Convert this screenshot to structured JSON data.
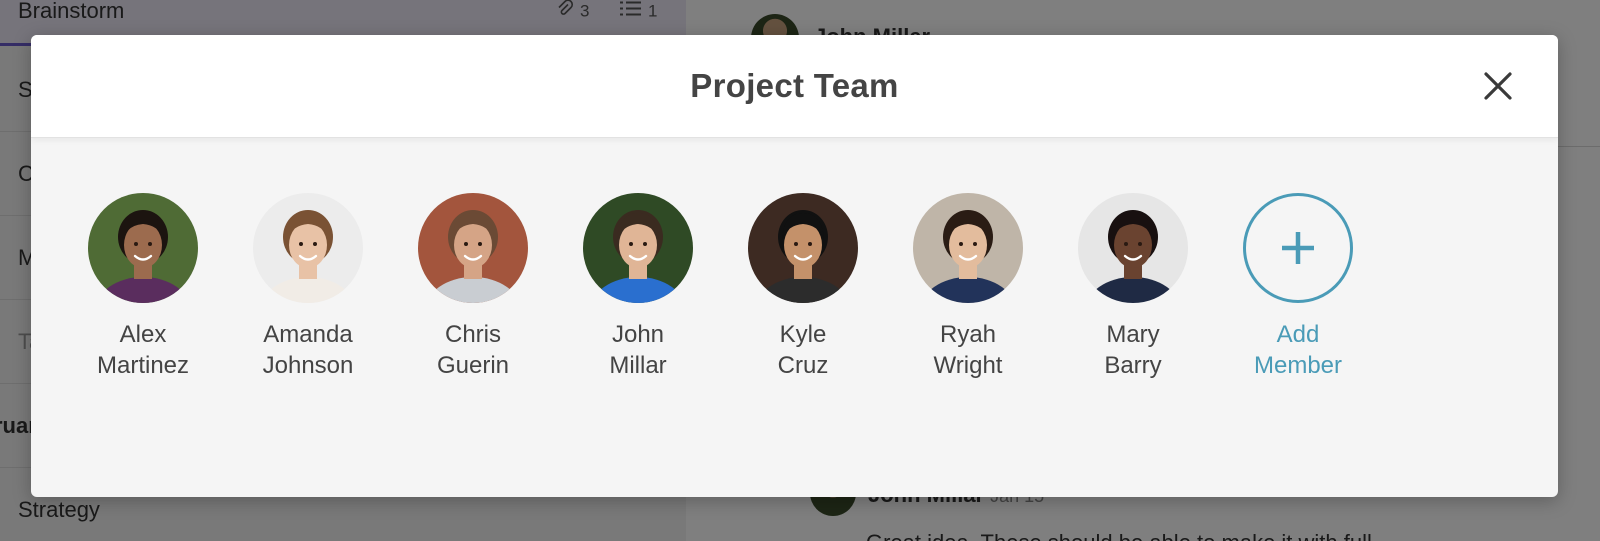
{
  "background": {
    "tasks": [
      {
        "label": "Brainstorm",
        "attachments": "3",
        "checklist": "1"
      },
      {
        "label": "S"
      },
      {
        "label": "C"
      },
      {
        "label": "M"
      },
      {
        "label": "Ta"
      },
      {
        "label": "ruar"
      },
      {
        "label": "Strategy"
      }
    ],
    "header_name": "John Millar",
    "comment": {
      "author": "John Millar",
      "date": "Jan 15",
      "text": "Great idea. These should be able to make it with full..."
    }
  },
  "modal": {
    "title": "Project Team",
    "close_icon": "close-icon",
    "members": [
      {
        "first": "Alex",
        "last": "Martinez",
        "skin": "#9c6b4e",
        "hair": "#1c1410",
        "shirt": "#5a2d5e",
        "bg": "#4f6b35"
      },
      {
        "first": "Amanda",
        "last": "Johnson",
        "skin": "#e8c2a6",
        "hair": "#7a5234",
        "shirt": "#f1ece6",
        "bg": "#ececec"
      },
      {
        "first": "Chris",
        "last": "Guerin",
        "skin": "#d5a486",
        "hair": "#6b4a35",
        "shirt": "#c9cdd2",
        "bg": "#a3553d"
      },
      {
        "first": "John",
        "last": "Millar",
        "skin": "#e0b596",
        "hair": "#3a2b20",
        "shirt": "#2a6fcf",
        "bg": "#2f4a25"
      },
      {
        "first": "Kyle",
        "last": "Cruz",
        "skin": "#c4916a",
        "hair": "#111111",
        "shirt": "#2c2c2c",
        "bg": "#3d2a22"
      },
      {
        "first": "Ryah",
        "last": "Wright",
        "skin": "#e3bc9d",
        "hair": "#2a1c14",
        "shirt": "#22335a",
        "bg": "#bfb5a8"
      },
      {
        "first": "Mary",
        "last": "Barry",
        "skin": "#6a4330",
        "hair": "#181010",
        "shirt": "#1f2a44",
        "bg": "#e6e6e6"
      }
    ],
    "add_member": {
      "first": "Add",
      "last": "Member"
    },
    "colors": {
      "accent": "#4a9bb7",
      "title": "#444444"
    }
  }
}
